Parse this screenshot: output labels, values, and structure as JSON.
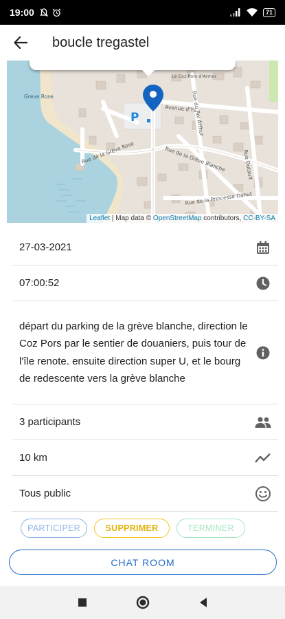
{
  "status_bar": {
    "time": "19:00",
    "battery": "71"
  },
  "app_bar": {
    "title": "boucle tregastel",
    "back_icon": "arrow-left-icon"
  },
  "map": {
    "streets": [
      "Greve Rose",
      "Avenue d'Ys",
      "Rue du Roi Arthur",
      "Rue de la Grève Rose",
      "Rue de la Grève Blanche",
      "Rue Dutault",
      "Rue de la Princesse Dahut",
      "Le Coz Pors d'Armor"
    ],
    "parking_label": "P",
    "attribution": {
      "leaflet": "Leaflet",
      "sep": " | Map data © ",
      "osm": "OpenStreetMap",
      "contrib": " contributors, ",
      "license": "CC-BY-SA"
    }
  },
  "details": {
    "date": "27-03-2021",
    "time": "07:00:52",
    "description": "départ du parking de la grève blanche, direction le Coz Pors par le sentier de douaniers, puis tour de l'île renote. ensuite direction super U, et le bourg de redescente vers la grève blanche",
    "participants": "3 participants",
    "distance": "10 km",
    "audience": "Tous public"
  },
  "actions": {
    "participer": "PARTICIPER",
    "supprimer": "SUPPRIMER",
    "terminer": "TERMINER",
    "chat_room": "CHAT ROOM"
  },
  "colors": {
    "primary": "#1e6bc9",
    "warning": "#f3c623",
    "success": "#a6e4c2",
    "disabled_blue": "#90b4e6"
  }
}
